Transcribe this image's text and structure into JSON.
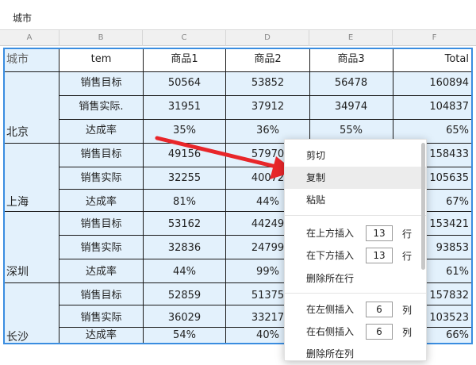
{
  "formula_bar": {
    "value": "城市"
  },
  "columns": [
    "A",
    "B",
    "C",
    "D",
    "E",
    "F"
  ],
  "header_row": [
    "城市",
    "tem",
    "商品1",
    "商品2",
    "商品3",
    "Total"
  ],
  "groups": [
    {
      "city": "北京",
      "rows": [
        {
          "label": "销售目标",
          "values": [
            "50564",
            "53852",
            "56478",
            "160894"
          ]
        },
        {
          "label": "销售实际.",
          "values": [
            "31951",
            "37912",
            "34974",
            "104837"
          ]
        },
        {
          "label": "达成率",
          "values": [
            "35%",
            "36%",
            "55%",
            "65%"
          ]
        }
      ]
    },
    {
      "city": "上海",
      "rows": [
        {
          "label": "销售目标",
          "values": [
            "49156",
            "57970",
            "",
            "158433"
          ]
        },
        {
          "label": "销售实际",
          "values": [
            "32255",
            "40072",
            "",
            "105635"
          ]
        },
        {
          "label": "达成率",
          "values": [
            "81%",
            "44%",
            "",
            "67%"
          ]
        }
      ]
    },
    {
      "city": "深圳",
      "rows": [
        {
          "label": "销售目标",
          "values": [
            "53162",
            "44249",
            "",
            "153421"
          ]
        },
        {
          "label": "销售实际",
          "values": [
            "32836",
            "24799",
            "",
            "93853"
          ]
        },
        {
          "label": "达成率",
          "values": [
            "44%",
            "99%",
            "",
            "61%"
          ]
        }
      ]
    },
    {
      "city": "长沙",
      "rows": [
        {
          "label": "销售目标",
          "values": [
            "52859",
            "51375",
            "",
            "157832"
          ]
        },
        {
          "label": "销售实际",
          "values": [
            "36029",
            "33217",
            "",
            "103523"
          ]
        },
        {
          "label": "达成率",
          "values": [
            "54%",
            "40%",
            "",
            "66%"
          ]
        }
      ]
    }
  ],
  "context_menu": {
    "cut": "剪切",
    "copy": "复制",
    "paste": "粘贴",
    "insert_above": {
      "label": "在上方插入",
      "value": "13",
      "unit": "行"
    },
    "insert_below": {
      "label": "在下方插入",
      "value": "13",
      "unit": "行"
    },
    "delete_row": "删除所在行",
    "insert_left": {
      "label": "在左侧插入",
      "value": "6",
      "unit": "列"
    },
    "insert_right": {
      "label": "在右侧插入",
      "value": "6",
      "unit": "列"
    },
    "delete_col": "删除所在列"
  },
  "colors": {
    "accent": "#3a8de0",
    "cell_fill": "#e3f1fc",
    "arrow": "#e8262a"
  }
}
